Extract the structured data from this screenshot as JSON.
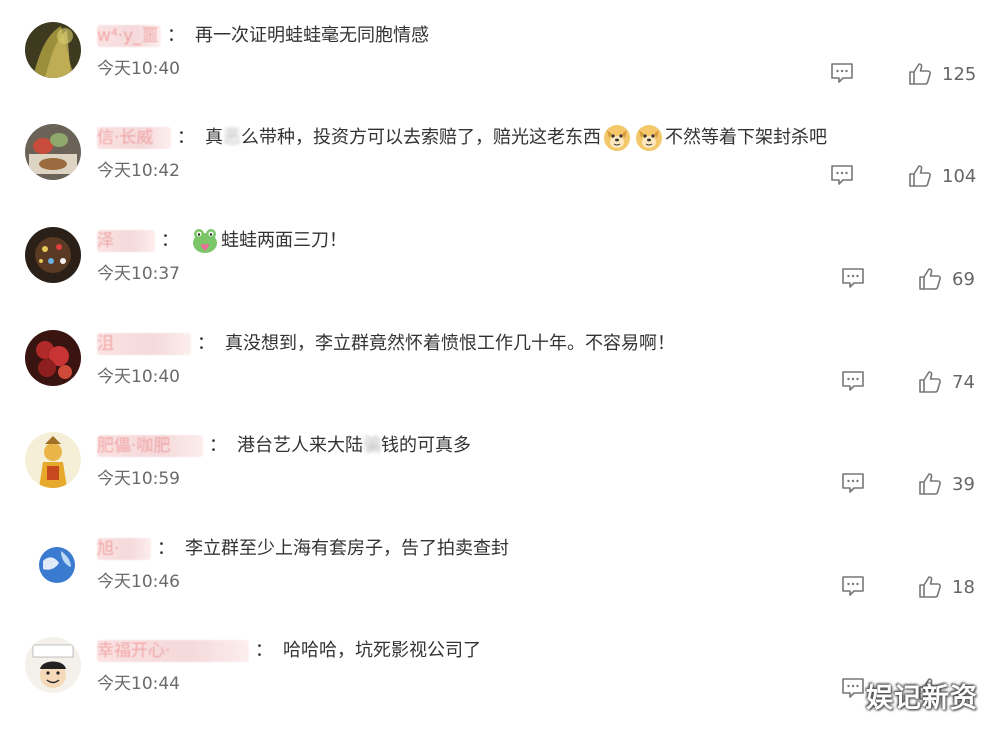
{
  "comments": [
    {
      "username": "w⁴·y_噩",
      "segments": [
        {
          "type": "text",
          "value": "再一次证明蛙蛙毫无同胞情感"
        }
      ],
      "time": "今天10:40",
      "likes": "125"
    },
    {
      "username": "信·长威",
      "segments": [
        {
          "type": "text",
          "value": "真"
        },
        {
          "type": "blur",
          "value": "恶"
        },
        {
          "type": "text",
          "value": "么带种，投资方可以去索赔了，赔光这老东西"
        },
        {
          "type": "emoji",
          "icon": "doge-emoji-icon"
        },
        {
          "type": "emoji",
          "icon": "doge-emoji-icon"
        },
        {
          "type": "text",
          "value": "不然等着下架封杀吧"
        }
      ],
      "time": "今天10:42",
      "likes": "104"
    },
    {
      "username": "泽",
      "segments": [
        {
          "type": "emoji",
          "icon": "frog-heart-emoji-icon"
        },
        {
          "type": "text",
          "value": "蛙蛙两面三刀！"
        }
      ],
      "time": "今天10:37",
      "likes": "69"
    },
    {
      "username": "沮",
      "segments": [
        {
          "type": "text",
          "value": "真没想到，李立群竟然怀着愤恨工作几十年。不容易啊！"
        }
      ],
      "time": "今天10:40",
      "likes": "74"
    },
    {
      "username": "肥儡·咖肥",
      "segments": [
        {
          "type": "text",
          "value": "港台艺人来大陆"
        },
        {
          "type": "blur",
          "value": "骗"
        },
        {
          "type": "text",
          "value": "钱的可真多"
        }
      ],
      "time": "今天10:59",
      "likes": "39"
    },
    {
      "username": "旭·",
      "segments": [
        {
          "type": "text",
          "value": "李立群至少上海有套房子，告了拍卖查封"
        }
      ],
      "time": "今天10:46",
      "likes": "18"
    },
    {
      "username": "幸福开心·",
      "segments": [
        {
          "type": "text",
          "value": "哈哈哈，坑死影视公司了"
        }
      ],
      "time": "今天10:44",
      "likes": ""
    }
  ],
  "icons": {
    "reply": "comment-icon",
    "like": "thumbs-up-icon"
  },
  "watermark": "娱记新资",
  "colors": {
    "text": "#333333",
    "time": "#6a6a6a",
    "icon": "#777777",
    "username_blur": "#f5d9db"
  }
}
